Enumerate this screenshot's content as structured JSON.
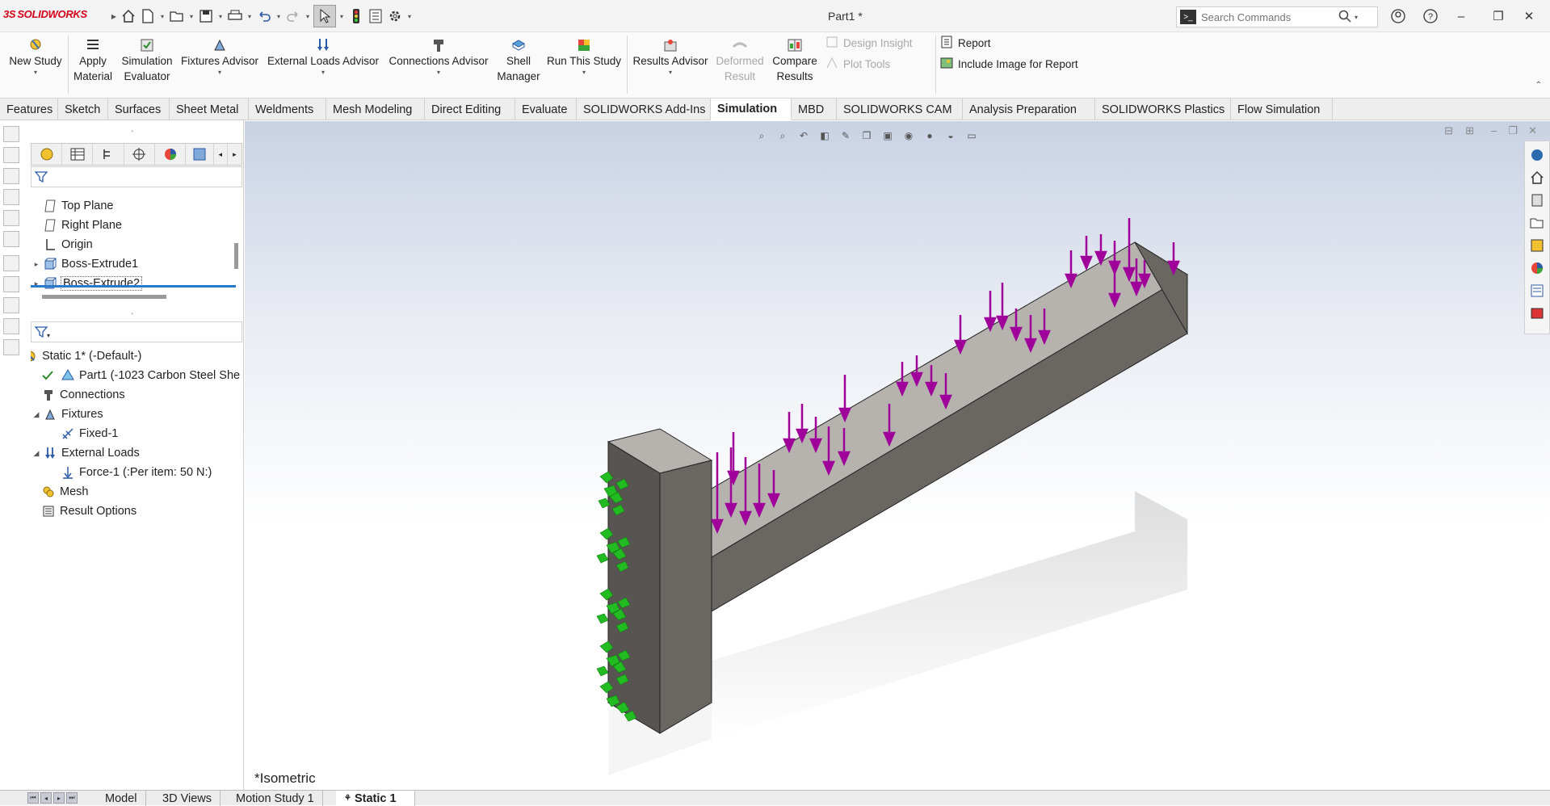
{
  "app": {
    "logo_brand": "SOLIDWORKS",
    "document_title": "Part1 *"
  },
  "search": {
    "placeholder": "Search Commands"
  },
  "ribbon": {
    "new_study": "New Study",
    "apply_material": "Apply Material",
    "simulation_evaluator": "Simulation Evaluator",
    "fixtures_advisor": "Fixtures Advisor",
    "external_loads_advisor": "External Loads Advisor",
    "connections_advisor": "Connections Advisor",
    "shell_manager": "Shell Manager",
    "run_this_study": "Run This Study",
    "results_advisor": "Results Advisor",
    "deformed_result": "Deformed Result",
    "compare_results": "Compare Results",
    "design_insight": "Design Insight",
    "plot_tools": "Plot Tools",
    "report": "Report",
    "include_image": "Include Image for Report"
  },
  "tabs": [
    "Features",
    "Sketch",
    "Surfaces",
    "Sheet Metal",
    "Weldments",
    "Mesh Modeling",
    "Direct Editing",
    "Evaluate",
    "SOLIDWORKS Add-Ins",
    "Simulation",
    "MBD",
    "SOLIDWORKS CAM",
    "Analysis Preparation",
    "SOLIDWORKS Plastics",
    "Flow Simulation"
  ],
  "active_tab": "Simulation",
  "feature_tree": [
    "Top Plane",
    "Right Plane",
    "Origin",
    "Boss-Extrude1",
    "Boss-Extrude2"
  ],
  "study_tree": {
    "study": "Static 1* (-Default-)",
    "part": "Part1 (-1023 Carbon Steel She",
    "connections": "Connections",
    "fixtures": "Fixtures",
    "fixed": "Fixed-1",
    "external_loads": "External Loads",
    "force": "Force-1 (:Per item: 50 N:)",
    "mesh": "Mesh",
    "result_options": "Result Options"
  },
  "viewport": {
    "view_label": "*Isometric"
  },
  "bottom_tabs": [
    "Model",
    "3D Views",
    "Motion Study 1",
    "Static 1"
  ],
  "colors": {
    "brand": "#d4001a",
    "load_arrow": "#a0009a",
    "fixture": "#22bb22",
    "part_top": "#b6b3af",
    "part_side": "#6a6662",
    "part_dark": "#585451"
  }
}
